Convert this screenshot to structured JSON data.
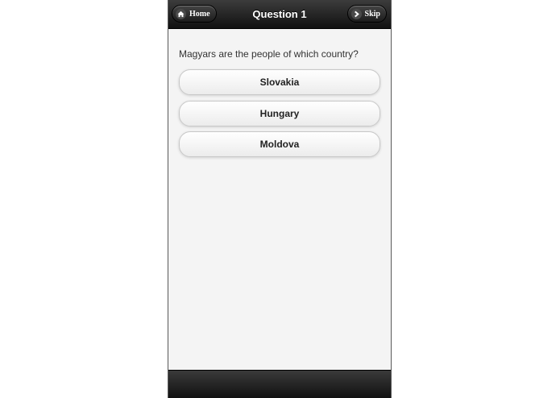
{
  "header": {
    "title": "Question 1",
    "home_label": "Home",
    "skip_label": "Skip"
  },
  "question": {
    "text": "Magyars are the people of which country?"
  },
  "answers": [
    {
      "label": "Slovakia"
    },
    {
      "label": "Hungary"
    },
    {
      "label": "Moldova"
    }
  ],
  "icons": {
    "home": "home-icon",
    "skip": "chevron-right-icon"
  }
}
